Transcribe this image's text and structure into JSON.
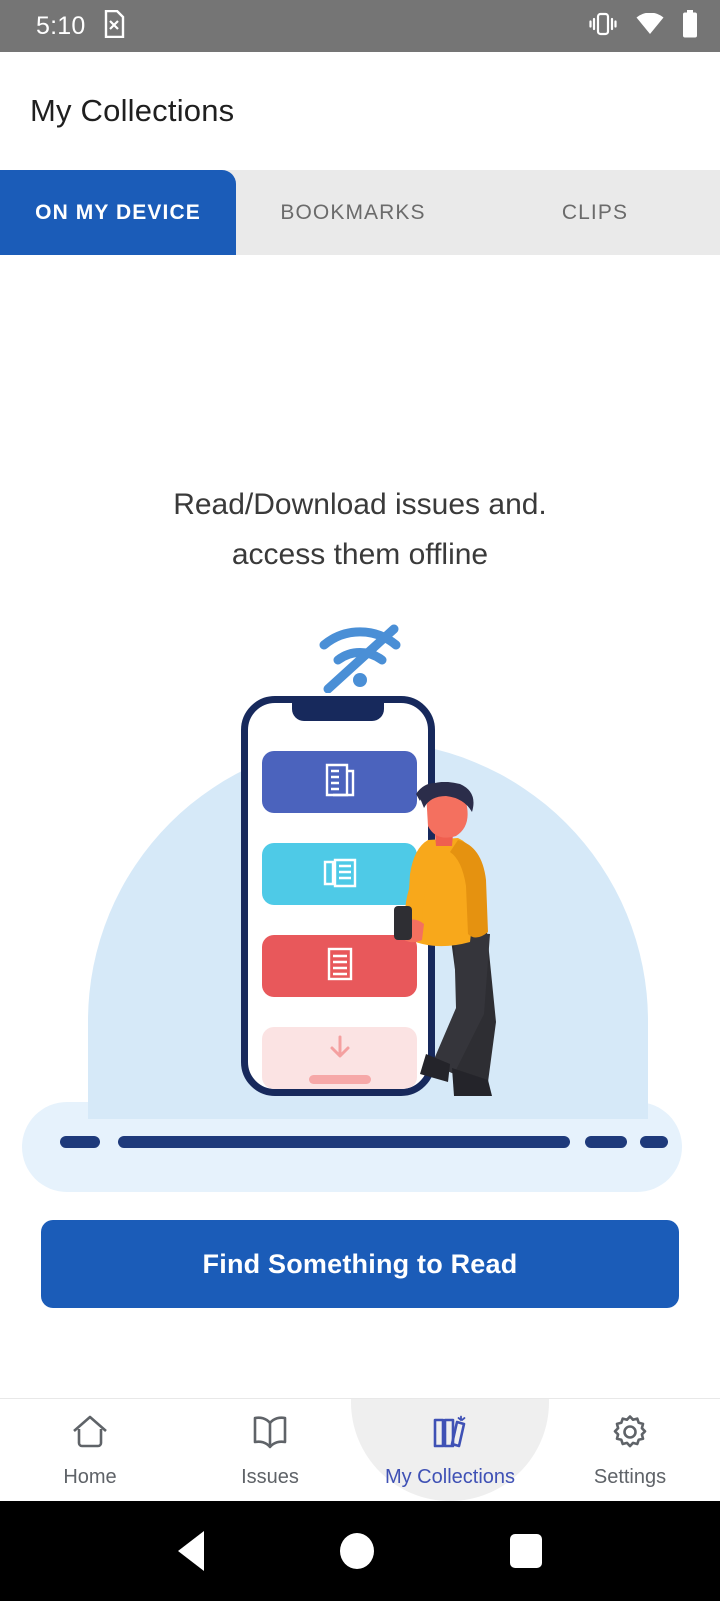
{
  "statusbar": {
    "time": "5:10",
    "icons": [
      "sim-card-x-icon",
      "vibrate-icon",
      "wifi-icon",
      "battery-full-icon"
    ]
  },
  "appbar": {
    "title": "My Collections"
  },
  "tabs": {
    "items": [
      {
        "label": "ON MY DEVICE",
        "active": true
      },
      {
        "label": "BOOKMARKS",
        "active": false
      },
      {
        "label": "CLIPS",
        "active": false
      }
    ],
    "active_bg": "#1b5cb8",
    "inactive_bg": "#eaeaea",
    "inactive_text": "#6b6b6b"
  },
  "empty_state": {
    "headline_line1": "Read/Download issues and.",
    "headline_line2": "access them offline",
    "icon": "wifi-off-icon",
    "illustration": {
      "name": "offline-reading-illustration",
      "dome_color": "#d6e9f8",
      "ground_color": "#1e3a7b",
      "phone_border": "#17295c",
      "cards": [
        {
          "name": "article-card",
          "color": "#4b63bd",
          "icon": "newspaper-icon"
        },
        {
          "name": "magazine-card",
          "color": "#4ecae7",
          "icon": "magazine-icon"
        },
        {
          "name": "document-card",
          "color": "#e8585b",
          "icon": "document-icon"
        },
        {
          "name": "download-card",
          "color": "#fbe3e3",
          "icon": "download-arrow-icon"
        }
      ],
      "person": {
        "hair": "#2b2d4a",
        "skin": "#f4705f",
        "sweater": "#f8a81b",
        "pants": "#2e2e33"
      }
    }
  },
  "cta": {
    "label": "Find Something to Read",
    "color": "#1b5cb8"
  },
  "bottomnav": {
    "items": [
      {
        "label": "Home",
        "icon": "home-icon",
        "active": false
      },
      {
        "label": "Issues",
        "icon": "open-book-icon",
        "active": false
      },
      {
        "label": "My Collections",
        "icon": "books-shelf-icon",
        "active": true
      },
      {
        "label": "Settings",
        "icon": "gear-icon",
        "active": false
      }
    ],
    "active_color": "#3f51b5",
    "inactive_color": "#5f6368"
  },
  "sysnav": {
    "items": [
      "back-button",
      "home-button",
      "recents-button"
    ]
  }
}
